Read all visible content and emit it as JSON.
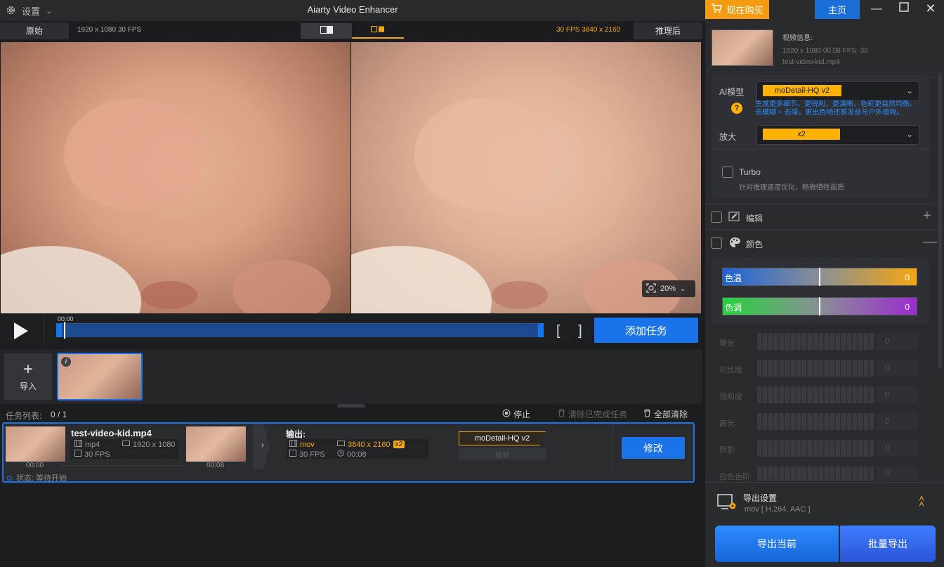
{
  "titlebar": {
    "settings_label": "设置",
    "app_title": "Aiarty Video Enhancer",
    "buy_label": "现在购买",
    "home_label": "主页"
  },
  "preview": {
    "left_tab": "原始",
    "left_info": "1920 x 1080  30 FPS",
    "right_info": "30 FPS  3840 x 2160",
    "right_tab": "推理后",
    "zoom": "20%"
  },
  "timeline": {
    "start_time": "00:00",
    "add_task_label": "添加任务"
  },
  "clips": {
    "import_label": "导入"
  },
  "tasklist": {
    "title": "任务列表:",
    "count": "0 / 1",
    "stop_label": "停止",
    "clear_done_label": "清除已完成任务",
    "clear_all_label": "全部清除"
  },
  "task": {
    "filename": "test-video-kid.mp4",
    "format": "mp4",
    "resolution": "1920 x 1080",
    "fps": "30 FPS",
    "time_start": "00:00",
    "time_end": "00:08",
    "output_label": "输出:",
    "out_format": "mov",
    "out_resolution": "3840 x 2160",
    "out_scale": "x2",
    "out_fps": "30 FPS",
    "out_duration": "00:08",
    "model": "moDetail-HQ  v2",
    "interp": "插帧",
    "edit_label": "修改",
    "status": "状态: 等待开始"
  },
  "right": {
    "video_info_title": "视频信息:",
    "video_info_line1": "1920 x 1080  00:08     FPS: 30",
    "video_info_file": "test-video-kid.mp4",
    "ai_model_label": "AI模型",
    "ai_model_value": "moDetail-HQ  v2",
    "ai_model_desc": "生成更多细节，更锐利，更清晰，色彩更自然均衡。去模糊 + 去噪，更出色地还原发丝与户外植物。",
    "upscale_label": "放大",
    "upscale_value": "x2",
    "turbo_label": "Turbo",
    "turbo_desc": "针对推理速度优化，略微牺牲画质",
    "edit_section": "编辑",
    "color_section": "颜色",
    "color_temp_label": "色温",
    "color_temp_value": "0",
    "tint_label": "色调",
    "tint_value": "0",
    "sliders": [
      {
        "label": "曝光",
        "value": "0"
      },
      {
        "label": "对比度",
        "value": "0"
      },
      {
        "label": "饱和度",
        "value": "0"
      },
      {
        "label": "高光",
        "value": "0"
      },
      {
        "label": "阴影",
        "value": "0"
      },
      {
        "label": "白色色阶",
        "value": "0"
      }
    ],
    "export_settings_label": "导出设置",
    "export_settings_value": "mov [ H.264, AAC ]",
    "export_current_label": "导出当前",
    "export_batch_label": "批量导出"
  },
  "colors": {
    "accent": "#1a73e8",
    "orange": "#f39c12",
    "highlight": "#ffb300"
  }
}
